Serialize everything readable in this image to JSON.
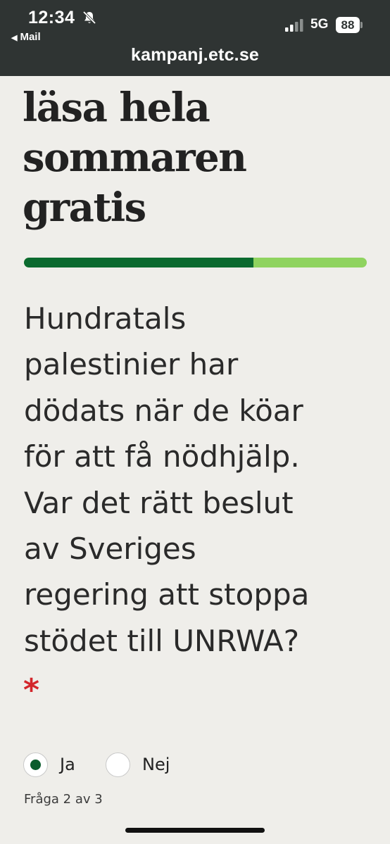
{
  "status_bar": {
    "time": "12:34",
    "back_label": "Mail",
    "network": "5G",
    "battery": "88",
    "icons": [
      "bell-slash-icon",
      "cellular-signal-icon",
      "battery-icon",
      "back-arrow-icon"
    ]
  },
  "browser": {
    "url": "kampanj.etc.se"
  },
  "headline": {
    "lines": [
      "läsa hela",
      "sommaren",
      "gratis"
    ]
  },
  "progress": {
    "fraction": 0.67,
    "fill_color": "#0b6a2f",
    "track_color": "#8fd35f"
  },
  "question": {
    "lines": [
      "Hundratals",
      "palestinier har",
      "dödats när de köar",
      "för att få nödhjälp.",
      "Var det rätt beslut",
      "av Sveriges",
      "regering att stoppa",
      "stödet till UNRWA?"
    ],
    "required_marker": "*",
    "required_color": "#d3262b"
  },
  "options": [
    {
      "label": "Ja",
      "selected": true
    },
    {
      "label": "Nej",
      "selected": false
    }
  ],
  "step_text": "Fråga 2 av 3"
}
